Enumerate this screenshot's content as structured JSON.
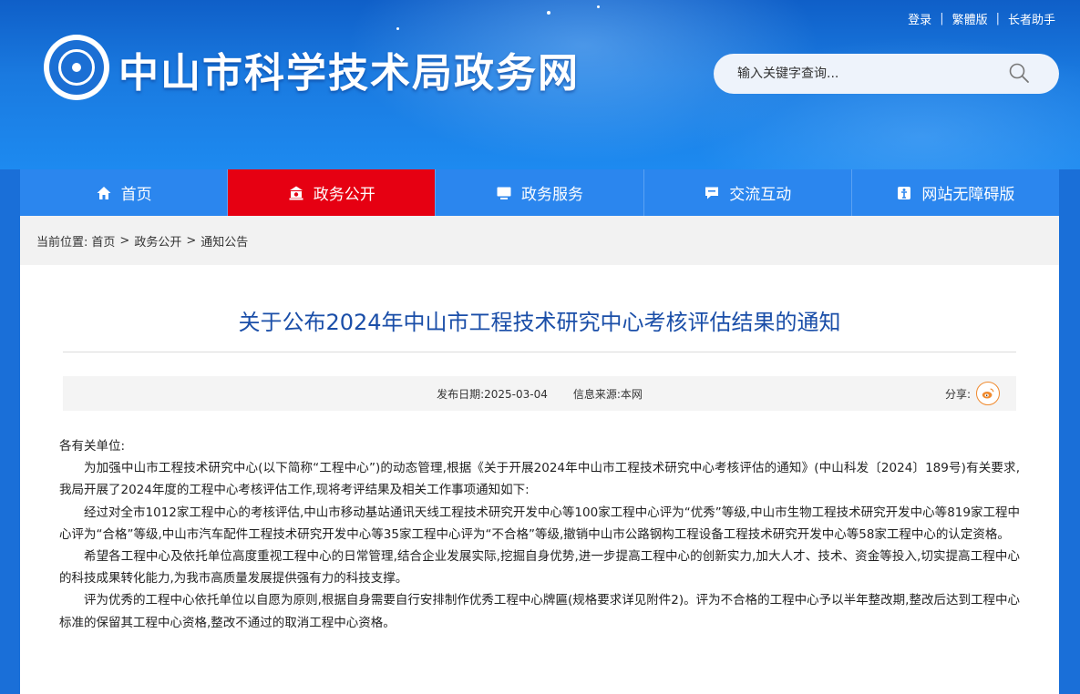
{
  "header": {
    "site_title": "中山市科学技术局政务网",
    "top_links": [
      "登录",
      "繁體版",
      "长者助手"
    ],
    "top_sep": "|",
    "search_placeholder": "输入关键字查询...",
    "logo_icon": "bureau-seal-logo"
  },
  "nav": {
    "items": [
      {
        "label": "首页",
        "icon": "home-icon"
      },
      {
        "label": "政务公开",
        "icon": "government-icon",
        "active": true
      },
      {
        "label": "政务服务",
        "icon": "monitor-icon"
      },
      {
        "label": "交流互动",
        "icon": "chat-icon"
      },
      {
        "label": "网站无障碍版",
        "icon": "accessibility-icon"
      }
    ]
  },
  "breadcrumb": {
    "prefix": "当前位置:",
    "items": [
      "首页",
      "政务公开",
      "通知公告"
    ],
    "sep": ">"
  },
  "article": {
    "title": "关于公布2024年中山市工程技术研究中心考核评估结果的通知",
    "publish_date": "发布日期:2025-03-04",
    "source": "信息来源:本网",
    "share_label": "分享:",
    "salutation": "各有关单位:",
    "paragraphs": [
      "为加强中山市工程技术研究中心(以下简称“工程中心”)的动态管理,根据《关于开展2024年中山市工程技术研究中心考核评估的通知》(中山科发〔2024〕189号)有关要求,我局开展了2024年度的工程中心考核评估工作,现将考评结果及相关工作事项通知如下:",
      "经过对全市1012家工程中心的考核评估,中山市移动基站通讯天线工程技术研究开发中心等100家工程中心评为“优秀”等级,中山市生物工程技术研究开发中心等819家工程中心评为“合格”等级,中山市汽车配件工程技术研究开发中心等35家工程中心评为“不合格”等级,撤销中山市公路钢构工程设备工程技术研究开发中心等58家工程中心的认定资格。",
      "希望各工程中心及依托单位高度重视工程中心的日常管理,结合企业发展实际,挖掘自身优势,进一步提高工程中心的创新实力,加大人才、技术、资金等投入,切实提高工程中心的科技成果转化能力,为我市高质量发展提供强有力的科技支撑。",
      "评为优秀的工程中心依托单位以自愿为原则,根据自身需要自行安排制作优秀工程中心牌匾(规格要求详见附件2)。评为不合格的工程中心予以半年整改期,整改后达到工程中心标准的保留其工程中心资格,整改不通过的取消工程中心资格。"
    ]
  },
  "colors": {
    "header_blue": "#1a7ae0",
    "nav_blue": "#2b86ee",
    "nav_active_red": "#e60012",
    "title_blue": "#1a4ea8",
    "weibo_orange": "#f08a2e"
  }
}
